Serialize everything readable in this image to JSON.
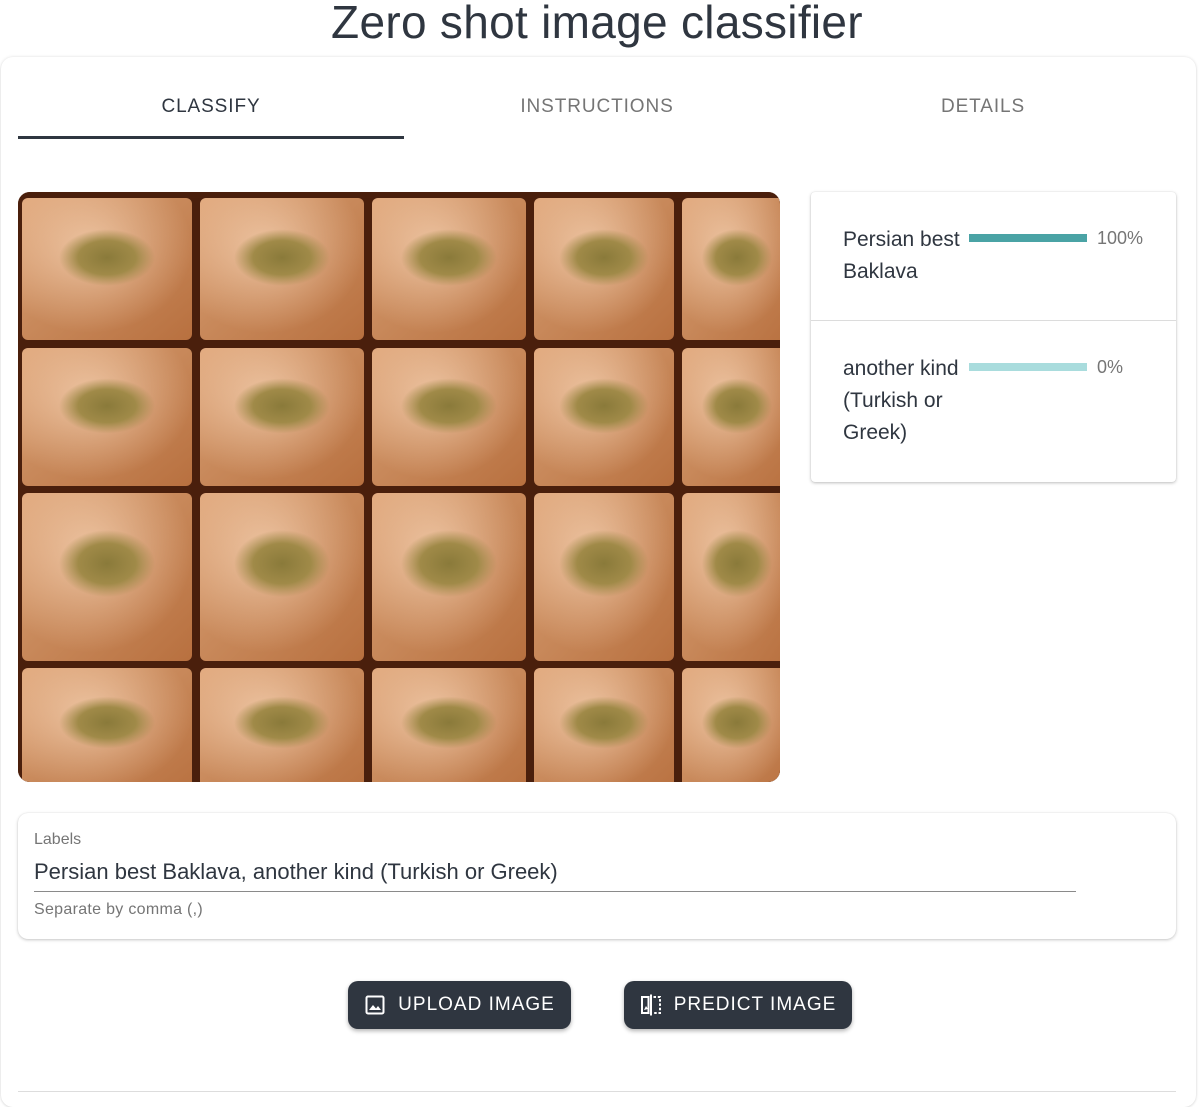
{
  "app": {
    "title": "Zero shot image classifier"
  },
  "tabs": [
    {
      "label": "CLASSIFY",
      "active": true
    },
    {
      "label": "INSTRUCTIONS",
      "active": false
    },
    {
      "label": "DETAILS",
      "active": false
    }
  ],
  "image_preview": {
    "subject": "tray of baklava squares topped with crushed pistachio"
  },
  "results": [
    {
      "label": "Persian best Baklava",
      "percent_text": "100%",
      "fraction": 1.0,
      "bar_color": "#4aa3a5"
    },
    {
      "label": "another kind (Turkish or Greek)",
      "percent_text": "0%",
      "fraction": 0.0,
      "bar_color": "#a9dcdd"
    }
  ],
  "labels_field": {
    "caption": "Labels",
    "value": "Persian best Baklava, another kind (Turkish or Greek)",
    "helper": "Separate by comma (,)"
  },
  "buttons": {
    "upload": {
      "label": "UPLOAD IMAGE",
      "icon": "image-icon"
    },
    "predict": {
      "label": "PREDICT IMAGE",
      "icon": "compare-icon"
    }
  },
  "colors": {
    "primary": "#2f3640",
    "accent_bar": "#4aa3a5",
    "accent_bar_light": "#a9dcdd"
  }
}
